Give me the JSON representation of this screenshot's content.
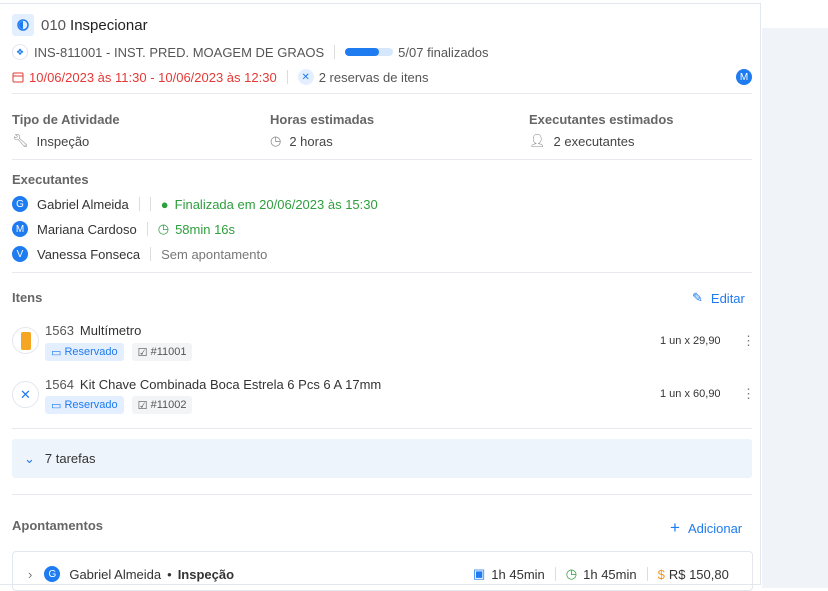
{
  "header": {
    "code": "010",
    "title": "Inspecionar",
    "asset": "INS-811001 - INST. PRED. MOAGEM DE GRAOS",
    "progress": 0.71,
    "progress_text": "5/07 finalizados",
    "dates": "10/06/2023 às 11:30 - 10/06/2023 às 12:30",
    "reservations": "2 reservas de itens",
    "avatar": "M"
  },
  "info": [
    {
      "label": "Tipo de Atividade",
      "value": "Inspeção"
    },
    {
      "label": "Horas estimadas",
      "value": "2 horas"
    },
    {
      "label": "Executantes estimados",
      "value": "2 executantes"
    }
  ],
  "executors": {
    "title": "Executantes",
    "list": [
      {
        "initial": "G",
        "name": "Gabriel Almeida",
        "status": "Finalizada em 20/06/2023 às 15:30"
      },
      {
        "initial": "M",
        "name": "Mariana Cardoso",
        "status": "58min 16s"
      },
      {
        "initial": "V",
        "name": "Vanessa Fonseca",
        "status": "Sem apontamento"
      }
    ]
  },
  "items": {
    "title": "Itens",
    "edit": "Editar",
    "list": [
      {
        "code": "1563",
        "name": "Multímetro",
        "status": "Reservado",
        "ref": "#11001",
        "qty": "1 un x 29,90"
      },
      {
        "code": "1564",
        "name": "Kit Chave Combinada Boca Estrela 6 Pcs 6 A 17mm",
        "status": "Reservado",
        "ref": "#11002",
        "qty": "1 un x 60,90"
      }
    ]
  },
  "tasks": {
    "label": "7 tarefas"
  },
  "appointments": {
    "title": "Apontamentos",
    "add": "Adicionar",
    "row": {
      "initial": "G",
      "name": "Gabriel Almeida",
      "type": "Inspeção",
      "planned": "1h 45min",
      "actual": "1h 45min",
      "currency": "$",
      "cost": "R$ 150,80"
    }
  }
}
